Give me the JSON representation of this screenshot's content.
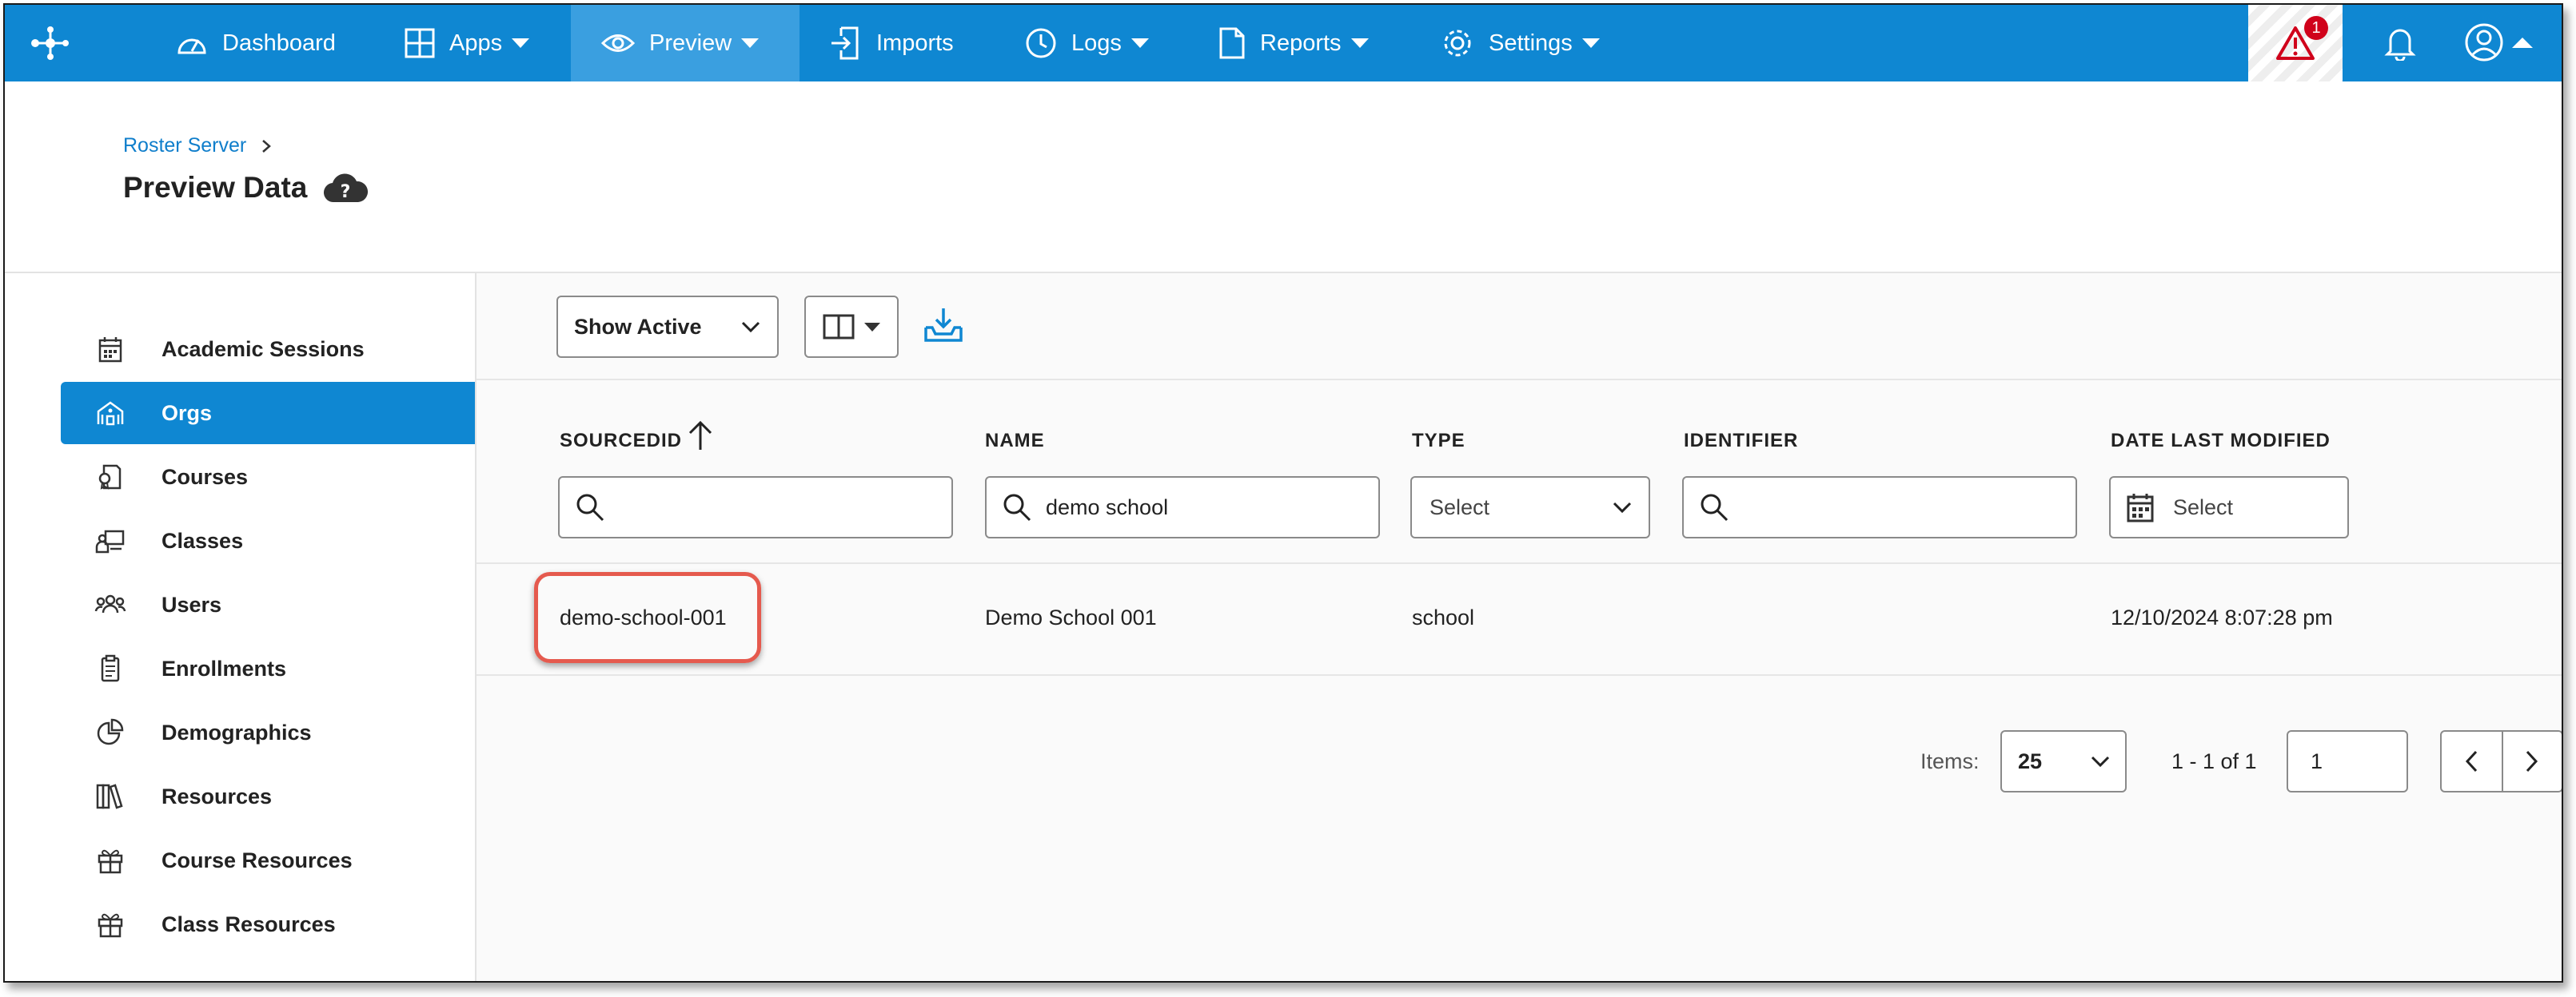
{
  "nav": {
    "items": [
      {
        "label": "Dashboard"
      },
      {
        "label": "Apps"
      },
      {
        "label": "Preview"
      },
      {
        "label": "Imports"
      },
      {
        "label": "Logs"
      },
      {
        "label": "Reports"
      },
      {
        "label": "Settings"
      }
    ],
    "alert_count": "1",
    "accent_color": "#0f87d2"
  },
  "breadcrumb": {
    "parent": "Roster Server"
  },
  "page": {
    "title": "Preview Data"
  },
  "sidebar": {
    "items": [
      {
        "label": "Academic Sessions",
        "icon": "calendar-icon"
      },
      {
        "label": "Orgs",
        "icon": "building-icon",
        "active": true
      },
      {
        "label": "Courses",
        "icon": "course-icon"
      },
      {
        "label": "Classes",
        "icon": "classroom-icon"
      },
      {
        "label": "Users",
        "icon": "users-icon"
      },
      {
        "label": "Enrollments",
        "icon": "clipboard-icon"
      },
      {
        "label": "Demographics",
        "icon": "pie-chart-icon"
      },
      {
        "label": "Resources",
        "icon": "books-icon"
      },
      {
        "label": "Course Resources",
        "icon": "gift-box-icon"
      },
      {
        "label": "Class Resources",
        "icon": "gift-box-icon"
      }
    ]
  },
  "toolbar": {
    "status_filter": "Show Active"
  },
  "table": {
    "columns": [
      {
        "label": "SOURCEDID"
      },
      {
        "label": "NAME"
      },
      {
        "label": "TYPE"
      },
      {
        "label": "IDENTIFIER"
      },
      {
        "label": "DATE LAST MODIFIED"
      }
    ],
    "filters": {
      "sourcedid": "",
      "name": "demo school",
      "type": "Select",
      "identifier": "",
      "date": "Select"
    },
    "rows": [
      {
        "sourcedid": "demo-school-001",
        "name": "Demo School 001",
        "type": "school",
        "identifier": "",
        "date_last_modified": "12/10/2024 8:07:28 pm"
      }
    ]
  },
  "pagination": {
    "items_label": "Items:",
    "page_size": "25",
    "range": "1 - 1 of 1",
    "page": "1"
  }
}
